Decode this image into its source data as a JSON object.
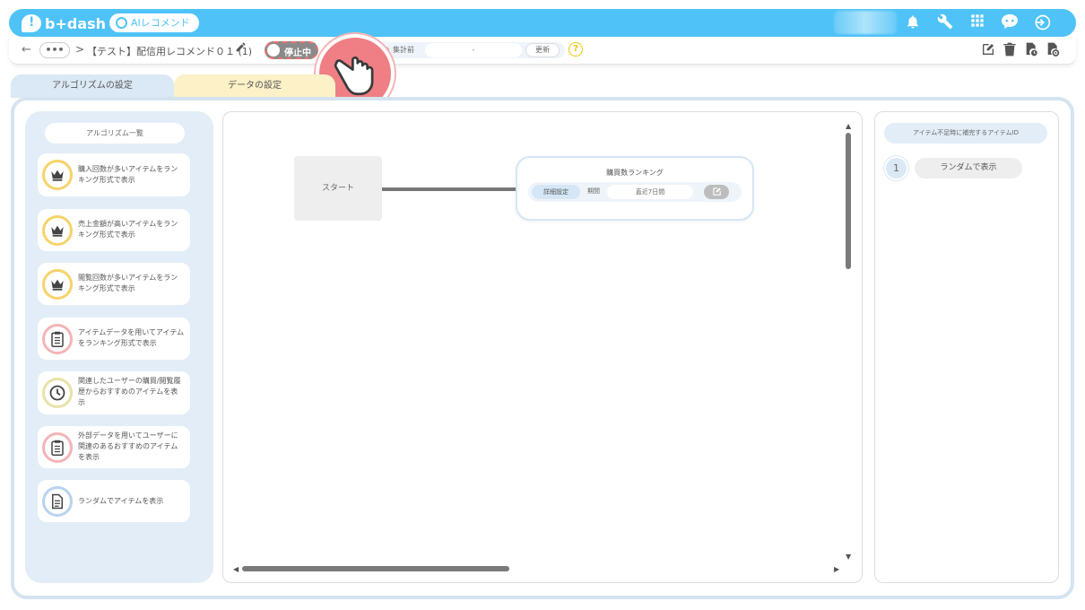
{
  "header": {
    "logo_text": "b+dash",
    "product_pill": "AIレコメンド",
    "icons": [
      "bell-icon",
      "wrench-icon",
      "grid-icon",
      "chat-bot-icon",
      "logout-icon"
    ],
    "accent_color": "#4fc3f7"
  },
  "toolbar": {
    "back_glyph": "←",
    "more_label": "•••",
    "separator": ">",
    "page_title": "【テスト】配信用レコメンド０１ (1)",
    "toggle_label": "停止中",
    "aggregation_status": "集計前",
    "aggregation_value": "-",
    "update_button": "更新",
    "help_glyph": "?",
    "right_icons": [
      "edit-icon",
      "trash-icon",
      "file-clock-icon",
      "file-settings-icon"
    ]
  },
  "tabs": [
    {
      "label": "アルゴリズムの設定",
      "active": true
    },
    {
      "label": "データの設定",
      "active": false
    }
  ],
  "algorithm_panel": {
    "header": "アルゴリズム一覧",
    "items": [
      {
        "icon": "crown-icon",
        "icon_color": "#f6d36b",
        "label": "購入回数が多いアイテムをランキング形式で表示"
      },
      {
        "icon": "crown-icon",
        "icon_color": "#f6d36b",
        "label": "売上金額が高いアイテムをランキング形式で表示"
      },
      {
        "icon": "crown-icon",
        "icon_color": "#f6d36b",
        "label": "閲覧回数が多いアイテムをランキング形式で表示"
      },
      {
        "icon": "clipboard-list-icon",
        "icon_color": "#f4b4b7",
        "label": "アイテムデータを用いてアイテムをランキング形式で表示"
      },
      {
        "icon": "clock-icon",
        "icon_color": "#e8e2a8",
        "label": "関連したユーザーの購買/閲覧履歴からおすすめのアイテムを表示"
      },
      {
        "icon": "clipboard-list-icon",
        "icon_color": "#f4b4b7",
        "label": "外部データを用いてユーザーに関連のあるおすすめのアイテムを表示"
      },
      {
        "icon": "document-icon",
        "icon_color": "#b9d2ee",
        "label": "ランダムでアイテムを表示"
      }
    ]
  },
  "canvas": {
    "start_node": "スタート",
    "ranking_node": {
      "title": "購買数ランキング",
      "detail_button": "詳細設定",
      "period_label": "期間",
      "period_value": "直近7日間"
    }
  },
  "right_panel": {
    "header": "アイテム不足時に補完するアイテムID",
    "items": [
      {
        "number": "1",
        "value": "ランダムで表示"
      }
    ]
  }
}
